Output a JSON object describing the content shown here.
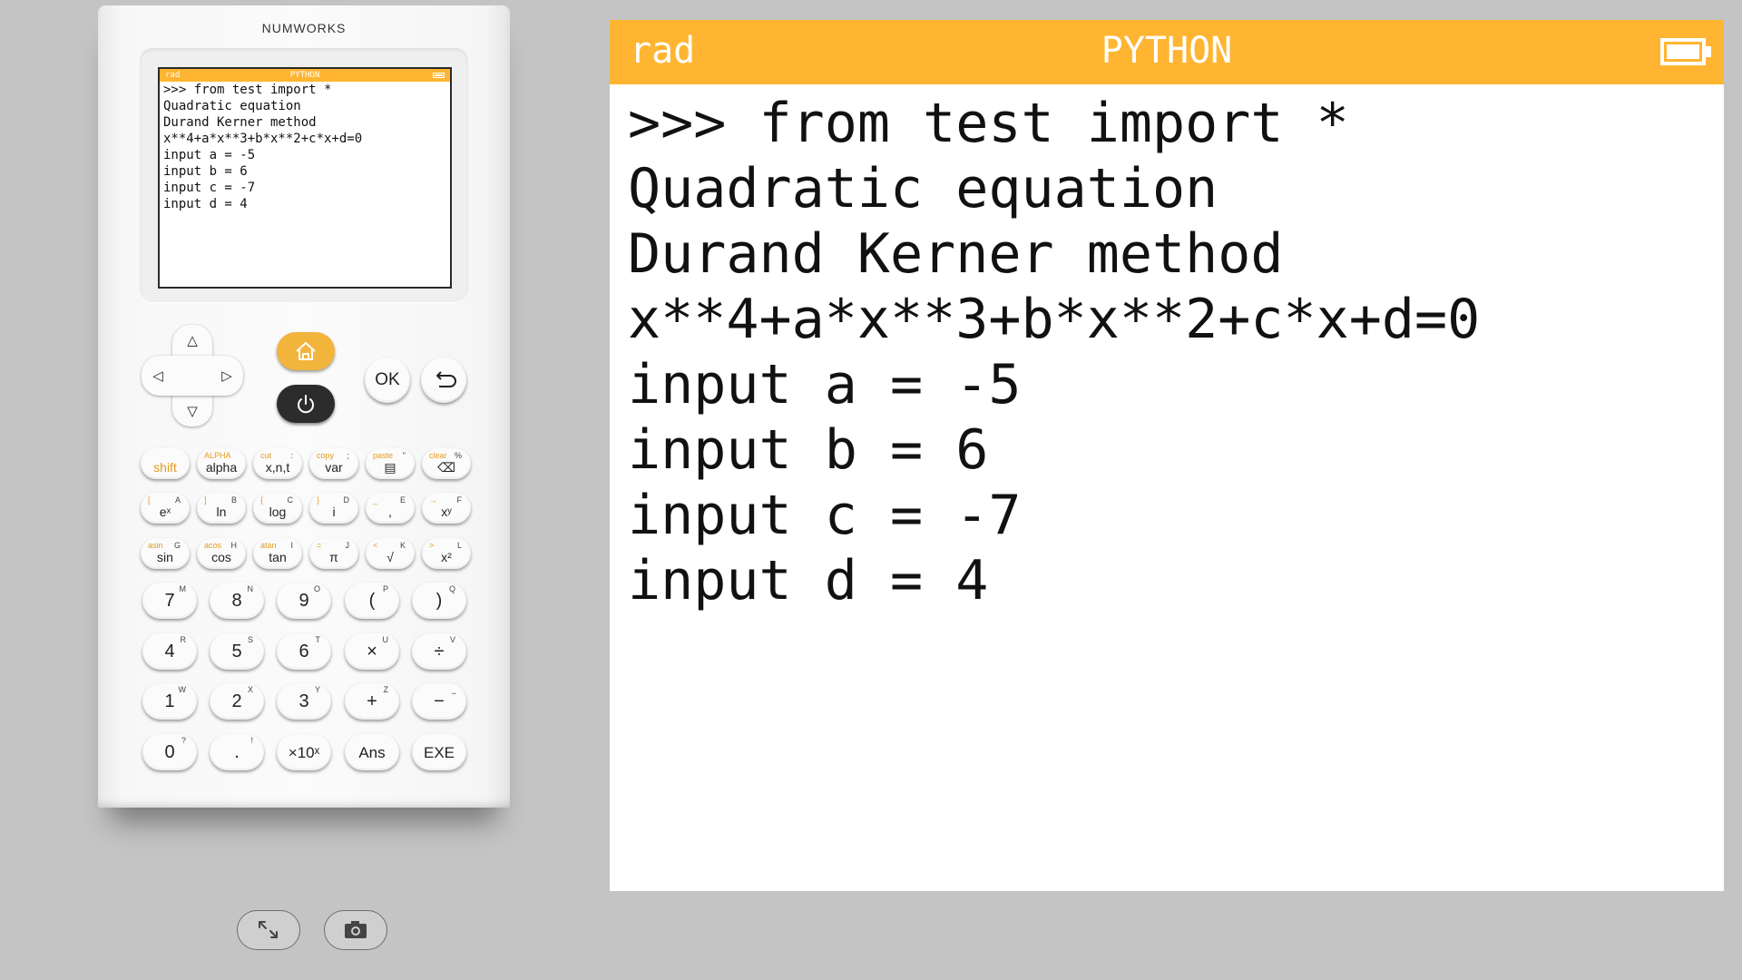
{
  "calculator": {
    "brand": "NUMWORKS",
    "mini_status": {
      "left": "rad",
      "center": "PYTHON"
    },
    "keys": {
      "ok": "OK",
      "row1": [
        {
          "main": "shift",
          "sub": "",
          "sup": ""
        },
        {
          "main": "alpha",
          "sub": "ALPHA",
          "sup": ""
        },
        {
          "main": "x,n,t",
          "sub": "cut",
          "sup": ":"
        },
        {
          "main": "var",
          "sub": "copy",
          "sup": ";"
        },
        {
          "main": "▤",
          "sub": "paste",
          "sup": "\""
        },
        {
          "main": "⌫",
          "sub": "clear",
          "sup": "%"
        }
      ],
      "row2": [
        {
          "main": "eˣ",
          "sub": "[",
          "sup": "A"
        },
        {
          "main": "ln",
          "sub": "]",
          "sup": "B"
        },
        {
          "main": "log",
          "sub": "{",
          "sup": "C"
        },
        {
          "main": "i",
          "sub": "}",
          "sup": "D"
        },
        {
          "main": ",",
          "sub": "_",
          "sup": "E"
        },
        {
          "main": "xʸ",
          "sub": "→",
          "sup": "F"
        }
      ],
      "row3": [
        {
          "main": "sin",
          "sub": "asin",
          "sup": "G"
        },
        {
          "main": "cos",
          "sub": "acos",
          "sup": "H"
        },
        {
          "main": "tan",
          "sub": "atan",
          "sup": "I"
        },
        {
          "main": "π",
          "sub": "=",
          "sup": "J"
        },
        {
          "main": "√",
          "sub": "<",
          "sup": "K"
        },
        {
          "main": "x²",
          "sub": ">",
          "sup": "L"
        }
      ],
      "row4": [
        {
          "main": "7",
          "sup": "M"
        },
        {
          "main": "8",
          "sup": "N"
        },
        {
          "main": "9",
          "sup": "O"
        },
        {
          "main": "(",
          "sup": "P"
        },
        {
          "main": ")",
          "sup": "Q"
        }
      ],
      "row5": [
        {
          "main": "4",
          "sup": "R"
        },
        {
          "main": "5",
          "sup": "S"
        },
        {
          "main": "6",
          "sup": "T"
        },
        {
          "main": "×",
          "sup": "U"
        },
        {
          "main": "÷",
          "sup": "V"
        }
      ],
      "row6": [
        {
          "main": "1",
          "sup": "W"
        },
        {
          "main": "2",
          "sup": "X"
        },
        {
          "main": "3",
          "sup": "Y"
        },
        {
          "main": "+",
          "sup": "Z"
        },
        {
          "main": "−",
          "sup": "⎵"
        }
      ],
      "row7": [
        {
          "main": "0",
          "sup": "?"
        },
        {
          "main": ".",
          "sup": "!"
        },
        {
          "main": "×10ˣ",
          "sup": ""
        },
        {
          "main": "Ans",
          "sup": ""
        },
        {
          "main": "EXE",
          "sup": ""
        }
      ]
    }
  },
  "screen": {
    "status": {
      "left": "rad",
      "center": "PYTHON"
    },
    "lines": [
      ">>> from test import *",
      "Quadratic equation",
      "Durand Kerner method",
      "x**4+a*x**3+b*x**2+c*x+d=0",
      "input a = -5",
      "input b = 6",
      "input c = -7",
      "input d = 4"
    ]
  },
  "icons": {
    "fullscreen": "expand-arrows-icon",
    "screenshot": "camera-icon",
    "home": "home-icon",
    "power": "power-icon",
    "back": "back-arrow-icon"
  },
  "colors": {
    "accent": "#ffb531",
    "background": "#c4c4c4"
  }
}
